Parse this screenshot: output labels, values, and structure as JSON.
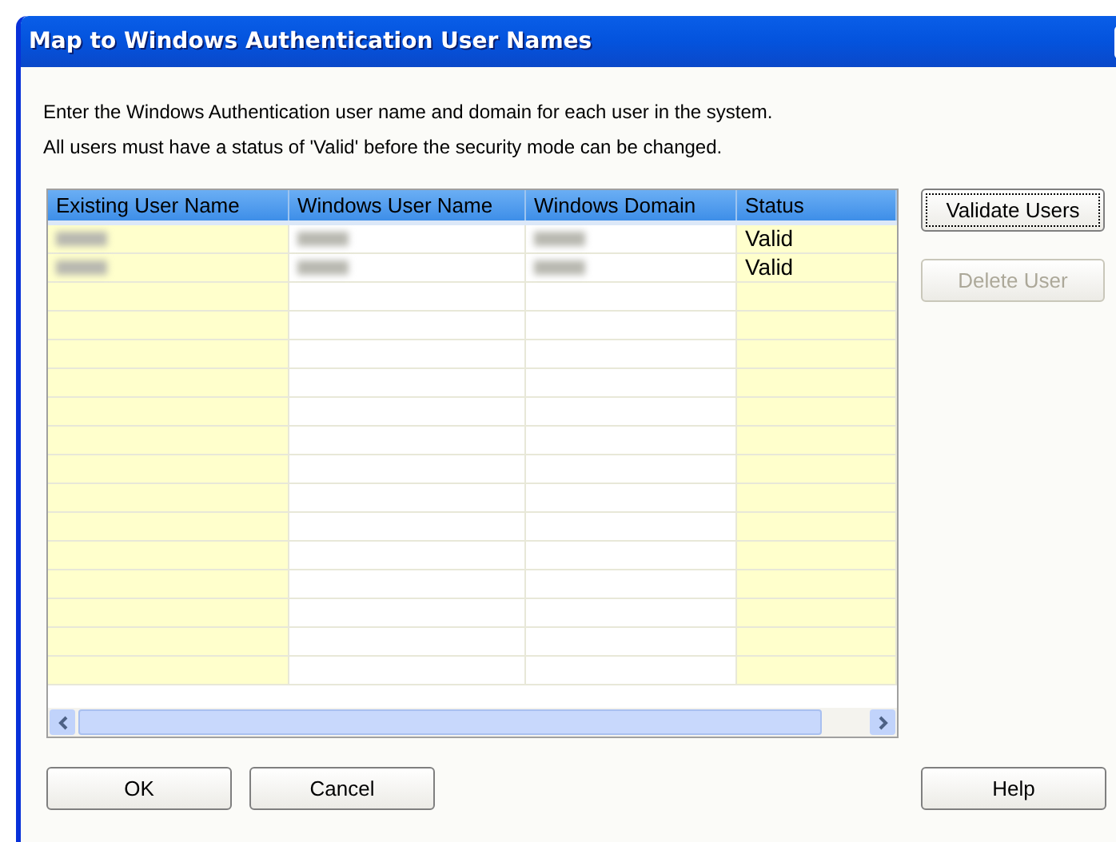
{
  "window": {
    "title": "Map to Windows Authentication User Names"
  },
  "instructions": [
    "Enter the Windows Authentication user name and domain for each user in the system.",
    "All users must have a status of 'Valid' before the security mode can be changed."
  ],
  "table": {
    "columns": [
      "Existing User Name",
      "Windows User Name",
      "Windows Domain",
      "Status"
    ],
    "rows": [
      {
        "status": "Valid"
      },
      {
        "status": "Valid"
      }
    ]
  },
  "side_buttons": [
    {
      "label": "Validate Users",
      "disabled": false,
      "focused": true
    },
    {
      "label": "Delete User",
      "disabled": true,
      "focused": false
    }
  ],
  "bottom_buttons": [
    {
      "label": "OK",
      "disabled": false
    },
    {
      "label": "Cancel",
      "disabled": false
    },
    {
      "label": "Help",
      "disabled": false
    }
  ]
}
